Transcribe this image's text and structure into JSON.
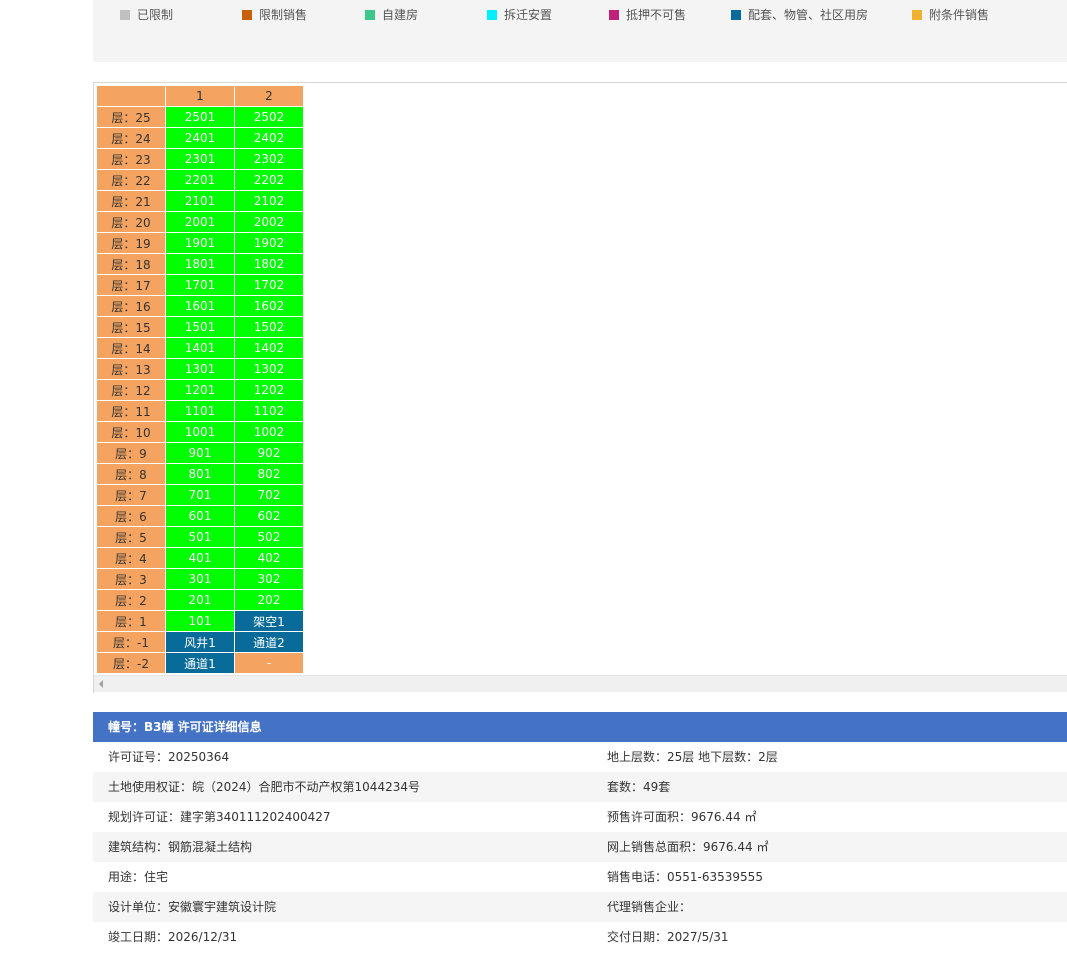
{
  "legend": [
    {
      "label": "已限制",
      "color": "#c0c0c0"
    },
    {
      "label": "限制销售",
      "color": "#c8600a"
    },
    {
      "label": "自建房",
      "color": "#3cc88c"
    },
    {
      "label": "拆迁安置",
      "color": "#00f0ff"
    },
    {
      "label": "抵押不可售",
      "color": "#c0207a"
    },
    {
      "label": "配套、物管、社区用房",
      "color": "#086b9a"
    },
    {
      "label": "附条件销售",
      "color": "#f0b030"
    }
  ],
  "grid": {
    "columns": [
      "",
      "1",
      "2"
    ],
    "rows": [
      {
        "floor": "层：25",
        "units": [
          "2501",
          "2502"
        ],
        "status": [
          "green",
          "green"
        ]
      },
      {
        "floor": "层：24",
        "units": [
          "2401",
          "2402"
        ],
        "status": [
          "green",
          "green"
        ]
      },
      {
        "floor": "层：23",
        "units": [
          "2301",
          "2302"
        ],
        "status": [
          "green",
          "green"
        ]
      },
      {
        "floor": "层：22",
        "units": [
          "2201",
          "2202"
        ],
        "status": [
          "green",
          "green"
        ]
      },
      {
        "floor": "层：21",
        "units": [
          "2101",
          "2102"
        ],
        "status": [
          "green",
          "green"
        ]
      },
      {
        "floor": "层：20",
        "units": [
          "2001",
          "2002"
        ],
        "status": [
          "green",
          "green"
        ]
      },
      {
        "floor": "层：19",
        "units": [
          "1901",
          "1902"
        ],
        "status": [
          "green",
          "green"
        ]
      },
      {
        "floor": "层：18",
        "units": [
          "1801",
          "1802"
        ],
        "status": [
          "green",
          "green"
        ]
      },
      {
        "floor": "层：17",
        "units": [
          "1701",
          "1702"
        ],
        "status": [
          "green",
          "green"
        ]
      },
      {
        "floor": "层：16",
        "units": [
          "1601",
          "1602"
        ],
        "status": [
          "green",
          "green"
        ]
      },
      {
        "floor": "层：15",
        "units": [
          "1501",
          "1502"
        ],
        "status": [
          "green",
          "green"
        ]
      },
      {
        "floor": "层：14",
        "units": [
          "1401",
          "1402"
        ],
        "status": [
          "green",
          "green"
        ]
      },
      {
        "floor": "层：13",
        "units": [
          "1301",
          "1302"
        ],
        "status": [
          "green",
          "green"
        ]
      },
      {
        "floor": "层：12",
        "units": [
          "1201",
          "1202"
        ],
        "status": [
          "green",
          "green"
        ]
      },
      {
        "floor": "层：11",
        "units": [
          "1101",
          "1102"
        ],
        "status": [
          "green",
          "green"
        ]
      },
      {
        "floor": "层：10",
        "units": [
          "1001",
          "1002"
        ],
        "status": [
          "green",
          "green"
        ]
      },
      {
        "floor": "层：9",
        "units": [
          "901",
          "902"
        ],
        "status": [
          "green",
          "green"
        ]
      },
      {
        "floor": "层：8",
        "units": [
          "801",
          "802"
        ],
        "status": [
          "green",
          "green"
        ]
      },
      {
        "floor": "层：7",
        "units": [
          "701",
          "702"
        ],
        "status": [
          "green",
          "green"
        ]
      },
      {
        "floor": "层：6",
        "units": [
          "601",
          "602"
        ],
        "status": [
          "green",
          "green"
        ]
      },
      {
        "floor": "层：5",
        "units": [
          "501",
          "502"
        ],
        "status": [
          "green",
          "green"
        ]
      },
      {
        "floor": "层：4",
        "units": [
          "401",
          "402"
        ],
        "status": [
          "green",
          "green"
        ]
      },
      {
        "floor": "层：3",
        "units": [
          "301",
          "302"
        ],
        "status": [
          "green",
          "green"
        ]
      },
      {
        "floor": "层：2",
        "units": [
          "201",
          "202"
        ],
        "status": [
          "green",
          "green"
        ]
      },
      {
        "floor": "层：1",
        "units": [
          "101",
          "架空1"
        ],
        "status": [
          "green",
          "blue"
        ]
      },
      {
        "floor": "层：-1",
        "units": [
          "风井1",
          "通道2"
        ],
        "status": [
          "blue",
          "blue"
        ]
      },
      {
        "floor": "层：-2",
        "units": [
          "通道1",
          "-"
        ],
        "status": [
          "blue",
          "empty"
        ]
      }
    ]
  },
  "info": {
    "title": "幢号：B3幢 许可证详细信息",
    "rows": [
      {
        "left": "许可证号：20250364",
        "right": "地上层数：25层  地下层数：2层"
      },
      {
        "left": "土地使用权证：皖（2024）合肥市不动产权第1044234号",
        "right": "套数：49套"
      },
      {
        "left": "规划许可证：建字第340111202400427",
        "right": "预售许可面积：9676.44 ㎡"
      },
      {
        "left": "建筑结构：钢筋混凝土结构",
        "right": "网上销售总面积：9676.44 ㎡"
      },
      {
        "left": "用途：住宅",
        "right": "销售电话：0551-63539555"
      },
      {
        "left": "设计单位：安徽寰宇建筑设计院",
        "right": "代理销售企业："
      },
      {
        "left": "竣工日期：2026/12/31",
        "right": "交付日期：2027/5/31"
      }
    ]
  }
}
